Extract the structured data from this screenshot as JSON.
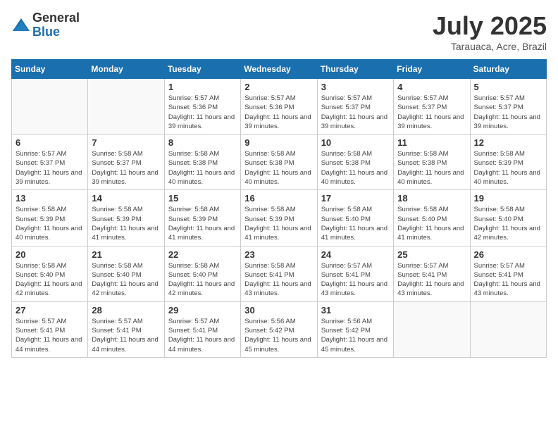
{
  "header": {
    "logo_general": "General",
    "logo_blue": "Blue",
    "month": "July 2025",
    "location": "Tarauaca, Acre, Brazil"
  },
  "weekdays": [
    "Sunday",
    "Monday",
    "Tuesday",
    "Wednesday",
    "Thursday",
    "Friday",
    "Saturday"
  ],
  "weeks": [
    [
      {
        "day": "",
        "info": ""
      },
      {
        "day": "",
        "info": ""
      },
      {
        "day": "1",
        "info": "Sunrise: 5:57 AM\nSunset: 5:36 PM\nDaylight: 11 hours and 39 minutes."
      },
      {
        "day": "2",
        "info": "Sunrise: 5:57 AM\nSunset: 5:36 PM\nDaylight: 11 hours and 39 minutes."
      },
      {
        "day": "3",
        "info": "Sunrise: 5:57 AM\nSunset: 5:37 PM\nDaylight: 11 hours and 39 minutes."
      },
      {
        "day": "4",
        "info": "Sunrise: 5:57 AM\nSunset: 5:37 PM\nDaylight: 11 hours and 39 minutes."
      },
      {
        "day": "5",
        "info": "Sunrise: 5:57 AM\nSunset: 5:37 PM\nDaylight: 11 hours and 39 minutes."
      }
    ],
    [
      {
        "day": "6",
        "info": "Sunrise: 5:57 AM\nSunset: 5:37 PM\nDaylight: 11 hours and 39 minutes."
      },
      {
        "day": "7",
        "info": "Sunrise: 5:58 AM\nSunset: 5:37 PM\nDaylight: 11 hours and 39 minutes."
      },
      {
        "day": "8",
        "info": "Sunrise: 5:58 AM\nSunset: 5:38 PM\nDaylight: 11 hours and 40 minutes."
      },
      {
        "day": "9",
        "info": "Sunrise: 5:58 AM\nSunset: 5:38 PM\nDaylight: 11 hours and 40 minutes."
      },
      {
        "day": "10",
        "info": "Sunrise: 5:58 AM\nSunset: 5:38 PM\nDaylight: 11 hours and 40 minutes."
      },
      {
        "day": "11",
        "info": "Sunrise: 5:58 AM\nSunset: 5:38 PM\nDaylight: 11 hours and 40 minutes."
      },
      {
        "day": "12",
        "info": "Sunrise: 5:58 AM\nSunset: 5:39 PM\nDaylight: 11 hours and 40 minutes."
      }
    ],
    [
      {
        "day": "13",
        "info": "Sunrise: 5:58 AM\nSunset: 5:39 PM\nDaylight: 11 hours and 40 minutes."
      },
      {
        "day": "14",
        "info": "Sunrise: 5:58 AM\nSunset: 5:39 PM\nDaylight: 11 hours and 41 minutes."
      },
      {
        "day": "15",
        "info": "Sunrise: 5:58 AM\nSunset: 5:39 PM\nDaylight: 11 hours and 41 minutes."
      },
      {
        "day": "16",
        "info": "Sunrise: 5:58 AM\nSunset: 5:39 PM\nDaylight: 11 hours and 41 minutes."
      },
      {
        "day": "17",
        "info": "Sunrise: 5:58 AM\nSunset: 5:40 PM\nDaylight: 11 hours and 41 minutes."
      },
      {
        "day": "18",
        "info": "Sunrise: 5:58 AM\nSunset: 5:40 PM\nDaylight: 11 hours and 41 minutes."
      },
      {
        "day": "19",
        "info": "Sunrise: 5:58 AM\nSunset: 5:40 PM\nDaylight: 11 hours and 42 minutes."
      }
    ],
    [
      {
        "day": "20",
        "info": "Sunrise: 5:58 AM\nSunset: 5:40 PM\nDaylight: 11 hours and 42 minutes."
      },
      {
        "day": "21",
        "info": "Sunrise: 5:58 AM\nSunset: 5:40 PM\nDaylight: 11 hours and 42 minutes."
      },
      {
        "day": "22",
        "info": "Sunrise: 5:58 AM\nSunset: 5:40 PM\nDaylight: 11 hours and 42 minutes."
      },
      {
        "day": "23",
        "info": "Sunrise: 5:58 AM\nSunset: 5:41 PM\nDaylight: 11 hours and 43 minutes."
      },
      {
        "day": "24",
        "info": "Sunrise: 5:57 AM\nSunset: 5:41 PM\nDaylight: 11 hours and 43 minutes."
      },
      {
        "day": "25",
        "info": "Sunrise: 5:57 AM\nSunset: 5:41 PM\nDaylight: 11 hours and 43 minutes."
      },
      {
        "day": "26",
        "info": "Sunrise: 5:57 AM\nSunset: 5:41 PM\nDaylight: 11 hours and 43 minutes."
      }
    ],
    [
      {
        "day": "27",
        "info": "Sunrise: 5:57 AM\nSunset: 5:41 PM\nDaylight: 11 hours and 44 minutes."
      },
      {
        "day": "28",
        "info": "Sunrise: 5:57 AM\nSunset: 5:41 PM\nDaylight: 11 hours and 44 minutes."
      },
      {
        "day": "29",
        "info": "Sunrise: 5:57 AM\nSunset: 5:41 PM\nDaylight: 11 hours and 44 minutes."
      },
      {
        "day": "30",
        "info": "Sunrise: 5:56 AM\nSunset: 5:42 PM\nDaylight: 11 hours and 45 minutes."
      },
      {
        "day": "31",
        "info": "Sunrise: 5:56 AM\nSunset: 5:42 PM\nDaylight: 11 hours and 45 minutes."
      },
      {
        "day": "",
        "info": ""
      },
      {
        "day": "",
        "info": ""
      }
    ]
  ]
}
